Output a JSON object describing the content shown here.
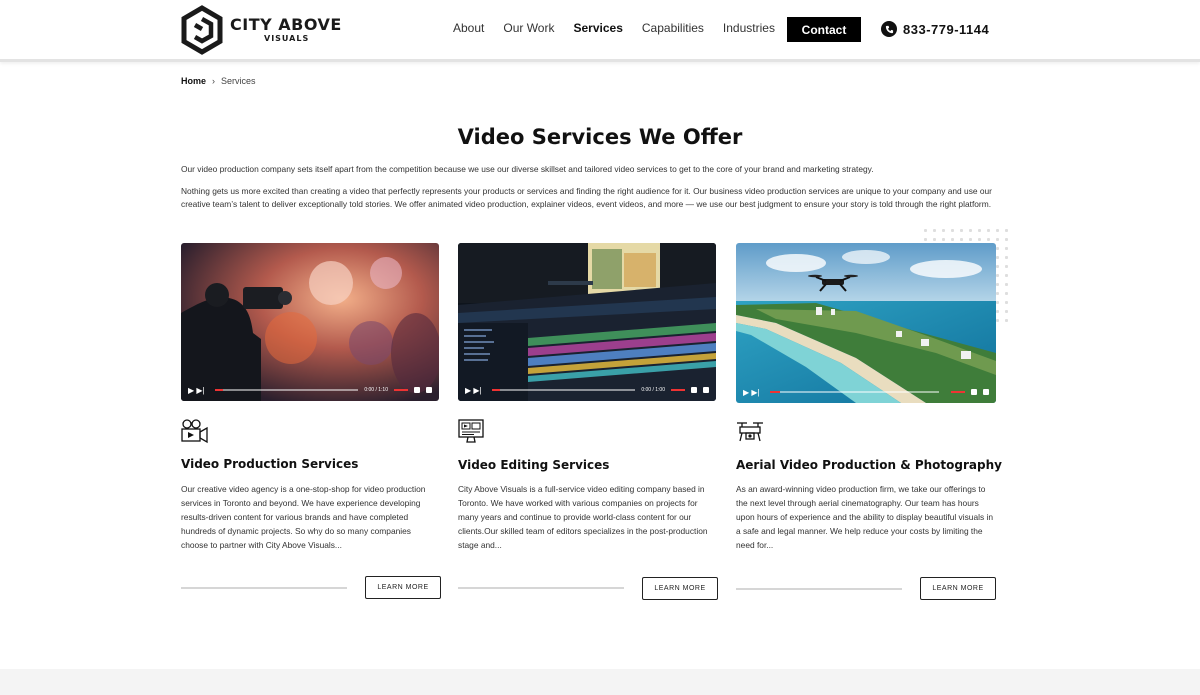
{
  "brand": {
    "name_line1": "CITY ABOVE",
    "name_line2": "VISUALS"
  },
  "nav": {
    "items": [
      {
        "label": "About"
      },
      {
        "label": "Our Work"
      },
      {
        "label": "Services"
      },
      {
        "label": "Capabilities"
      },
      {
        "label": "Industries"
      }
    ],
    "active": "Services",
    "contact_label": "Contact",
    "phone": "833-779-1144"
  },
  "breadcrumb": {
    "home": "Home",
    "current": "Services"
  },
  "main": {
    "title": "Video Services We Offer",
    "intro_1": "Our video production company sets itself apart from the competition because we use our diverse skillset and tailored video services to get to the core of your brand and marketing strategy.",
    "intro_2": "Nothing gets us more excited than creating a video that perfectly represents your products or services and finding the right audience for it. Our business video production services are unique to your company and use our creative team’s talent to deliver exceptionally told stories. We offer animated video production, explainer videos, event videos, and more — we use our best judgment to ensure your story is told through the right platform."
  },
  "services": [
    {
      "icon": "video-camera-icon",
      "title": "Video Production Services",
      "description": "Our creative video agency is a one-stop-shop for video production services in Toronto and beyond. We have experience developing results-driven content for various brands and have completed hundreds of dynamic projects. So why do so many companies choose to partner with City Above Visuals...",
      "button": "LEARN MORE",
      "video_time": "0:00 / 1:10"
    },
    {
      "icon": "editing-monitor-icon",
      "title": "Video Editing Services",
      "description": "City Above Visuals is a full-service video editing company based in Toronto. We have worked with various companies on projects for many years and continue to provide world-class content for our clients.Our skilled team of editors specializes in the post-production stage and...",
      "button": "LEARN MORE",
      "video_time": "0:00 / 1:00"
    },
    {
      "icon": "drone-icon",
      "title": "Aerial Video Production & Photography",
      "description": "As an award-winning video production firm, we take our offerings to the next level through aerial cinematography. Our team has hours upon hours of experience and the ability to display beautiful visuals in a safe and legal manner. We help reduce your costs by limiting the need for...",
      "button": "LEARN MORE",
      "video_time": ""
    }
  ],
  "colors": {
    "accent": "#000000",
    "progress": "#e33333"
  }
}
